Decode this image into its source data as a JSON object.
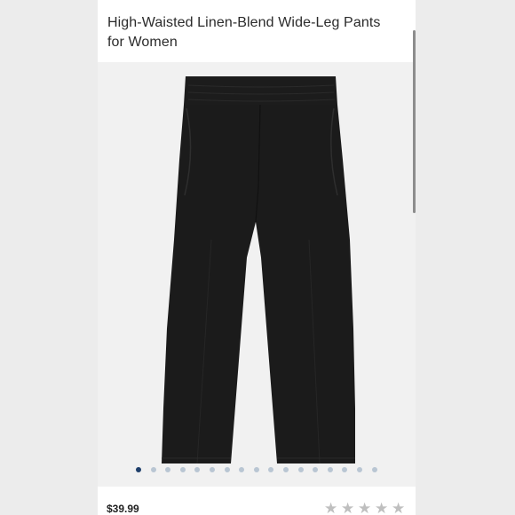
{
  "product": {
    "title": "High-Waisted Linen-Blend Wide-Leg Pants for Women",
    "price": "$39.99",
    "color": "#1b1b1b"
  },
  "carousel": {
    "count": 17,
    "active_index": 0,
    "active_color": "#1f3f6b",
    "inactive_color": "#b9c6d3"
  },
  "rating": {
    "stars_total": 5,
    "stars_filled": 0,
    "star_color": "#bfbfbf",
    "star_glyph": "★"
  }
}
